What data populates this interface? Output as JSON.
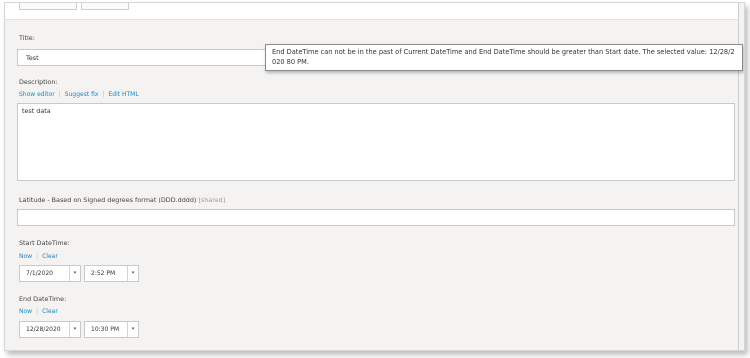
{
  "form": {
    "title_label": "Title:",
    "title_value": "Test",
    "description_label": "Description:",
    "editor_links": [
      "Show editor",
      "Suggest fix",
      "Edit HTML"
    ],
    "description_value": "test data",
    "latitude_label": "Latitude - Based on Signed degrees format (DDD.dddd)",
    "latitude_tag": "[shared]",
    "latitude_value": "",
    "start_label": "Start DateTime:",
    "start_links": [
      "Now",
      "Clear"
    ],
    "start_date": "7/1/2020",
    "start_time": "2:52 PM",
    "end_label": "End DateTime:",
    "end_links": [
      "Now",
      "Clear"
    ],
    "end_date": "12/28/2020",
    "end_time": "10:30 PM"
  },
  "tooltip": {
    "text": "End DateTime can not be in the past of Current DateTime and End DateTime should be greater than Start date. The selected value: 12/28/2020 80 PM."
  },
  "icons": {
    "dropdown": "▾"
  }
}
